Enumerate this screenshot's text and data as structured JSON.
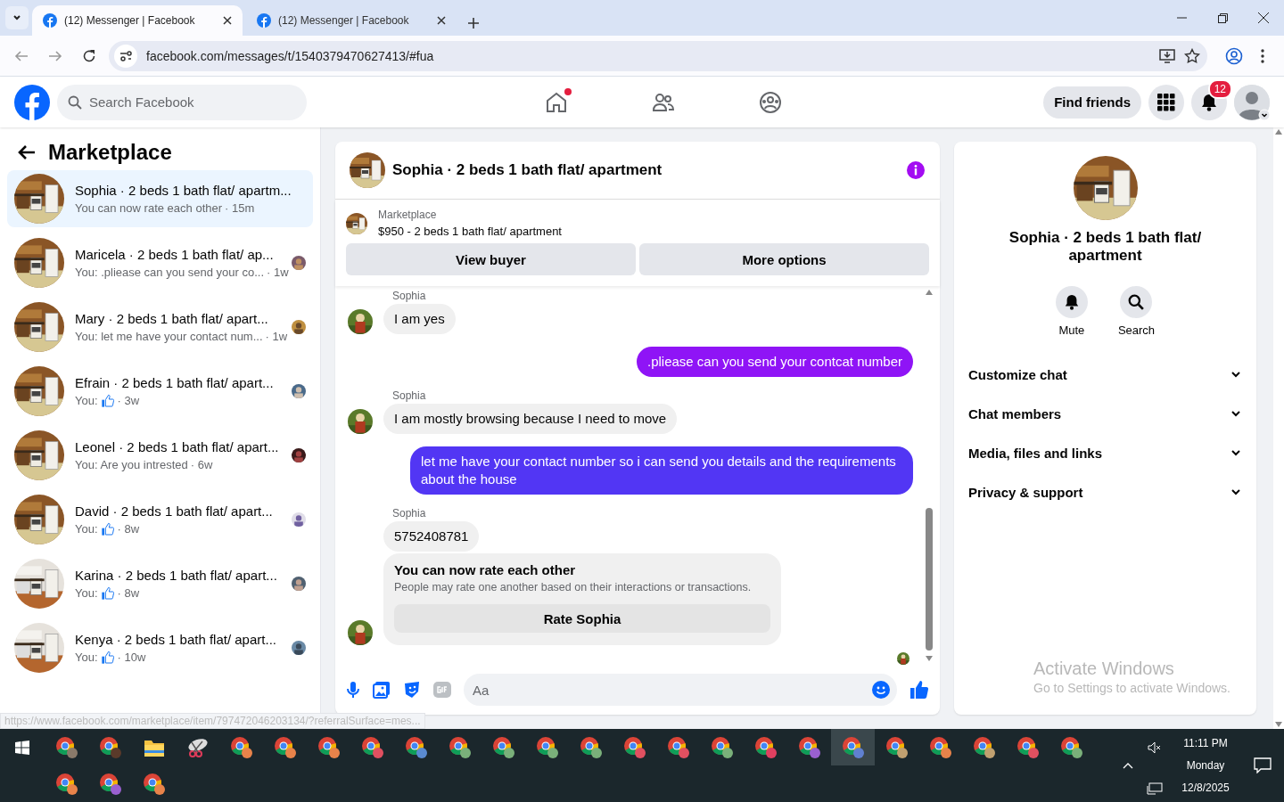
{
  "browser": {
    "tabs": [
      {
        "title": "(12) Messenger | Facebook",
        "selected": true
      },
      {
        "title": "(12) Messenger | Facebook",
        "selected": false
      }
    ],
    "url": "facebook.com/messages/t/1540379470627413/#fua"
  },
  "header": {
    "search_placeholder": "Search Facebook",
    "home_notification": true,
    "find_friends": "Find friends",
    "notification_count": "12"
  },
  "sidebar": {
    "title": "Marketplace",
    "conversations": [
      {
        "title": "Sophia · 2 beds 1 bath flat/ apartm...",
        "kind": "text",
        "preview": "You can now rate each other",
        "time": "· 15m",
        "selected": true,
        "seen": false
      },
      {
        "title": "Maricela · 2 beds 1 bath flat/ ap...",
        "kind": "text",
        "preview": "You: .pliease can you send your co...",
        "time": "· 1w",
        "selected": false,
        "seen": true
      },
      {
        "title": "Mary · 2 beds 1 bath flat/ apart...",
        "kind": "text",
        "preview": "You: let me have your contact num...",
        "time": "· 1w",
        "selected": false,
        "seen": true
      },
      {
        "title": "Efrain · 2 beds 1 bath flat/ apart...",
        "kind": "like",
        "preview": "You:",
        "time": "· 3w",
        "selected": false,
        "seen": true
      },
      {
        "title": "Leonel · 2 beds 1 bath flat/ apart...",
        "kind": "text",
        "preview": "You: Are you intrested",
        "time": "· 6w",
        "selected": false,
        "seen": true
      },
      {
        "title": "David · 2 beds 1 bath flat/ apart...",
        "kind": "like",
        "preview": "You:",
        "time": "· 8w",
        "selected": false,
        "seen": true
      },
      {
        "title": "Karina · 2 beds 1 bath flat/ apart...",
        "kind": "like",
        "preview": "You:",
        "time": "· 8w",
        "selected": false,
        "seen": true
      },
      {
        "title": "Kenya · 2 beds 1 bath flat/ apart...",
        "kind": "like",
        "preview": "You:",
        "time": "· 10w",
        "selected": false,
        "seen": true
      }
    ]
  },
  "chat": {
    "title": "Sophia · 2 beds 1 bath flat/ apartment",
    "listing": {
      "label": "Marketplace",
      "title": "$950 - 2 beds 1 bath flat/ apartment"
    },
    "buttons": [
      "View buyer",
      "More options"
    ],
    "groups": [
      {
        "kind": "incoming",
        "sender": "Sophia",
        "items": [
          {
            "kind": "text",
            "text": "I am yes"
          }
        ]
      },
      {
        "kind": "outgoing",
        "items": [
          {
            "kind": "text",
            "text": ".pliease can you send your contcat number",
            "color": "#8f14f6"
          }
        ]
      },
      {
        "kind": "incoming",
        "sender": "Sophia",
        "items": [
          {
            "kind": "text",
            "text": "I am mostly browsing because I need to move"
          }
        ]
      },
      {
        "kind": "outgoing",
        "items": [
          {
            "kind": "text",
            "text": "let me have your contact number so i can send you details and the requirements about the house",
            "color": "#5236f4"
          }
        ]
      },
      {
        "kind": "incoming",
        "sender": "Sophia",
        "items": [
          {
            "kind": "text",
            "text": "5752408781"
          },
          {
            "kind": "rating",
            "title": "You can now rate each other",
            "text": "People may rate one another based on their interactions or transactions.",
            "button": "Rate Sophia"
          }
        ]
      }
    ],
    "composer_placeholder": "Aa"
  },
  "details": {
    "title": "Sophia · 2 beds 1 bath flat/ apartment",
    "actions": [
      {
        "kind": "bell",
        "label": "Mute"
      },
      {
        "kind": "search",
        "label": "Search"
      }
    ],
    "sections": [
      "Customize chat",
      "Chat members",
      "Media, files and links",
      "Privacy & support"
    ]
  },
  "activation_notice": {
    "title": "Activate Windows",
    "text": "Go to Settings to activate Windows."
  },
  "status_link": "https://www.facebook.com/marketplace/item/797472046203134/?referralSurface=mes...",
  "taskbar": {
    "apps": [
      {
        "kind": "chrome",
        "color": "#8a7a6a",
        "selected": false
      },
      {
        "kind": "chrome",
        "color": "#5a3a2a",
        "selected": false
      },
      {
        "kind": "folder",
        "selected": false
      },
      {
        "kind": "snip",
        "selected": false
      },
      {
        "kind": "chrome",
        "color": "#e8834a",
        "selected": false
      },
      {
        "kind": "chrome",
        "color": "#e8834a",
        "selected": false
      },
      {
        "kind": "chrome",
        "color": "#e8834a",
        "selected": false
      },
      {
        "kind": "chrome",
        "color": "#e05060",
        "selected": false
      },
      {
        "kind": "chrome",
        "color": "#5a8ad0",
        "selected": false
      },
      {
        "kind": "chrome",
        "color": "#7ab07a",
        "selected": false
      },
      {
        "kind": "chrome",
        "color": "#7ab07a",
        "selected": false
      },
      {
        "kind": "chrome",
        "color": "#7ab07a",
        "selected": false
      },
      {
        "kind": "chrome",
        "color": "#7ab07a",
        "selected": false
      },
      {
        "kind": "chrome",
        "color": "#e05060",
        "selected": false
      },
      {
        "kind": "chrome",
        "color": "#e05060",
        "selected": false
      },
      {
        "kind": "chrome",
        "color": "#7ab07a",
        "selected": false
      },
      {
        "kind": "chrome",
        "color": "#e04060",
        "selected": false
      },
      {
        "kind": "chrome",
        "color": "#9a60d0",
        "selected": false
      },
      {
        "kind": "chrome",
        "color": "#6080d0",
        "selected": true
      },
      {
        "kind": "chrome",
        "color": "#c0a070",
        "selected": false
      },
      {
        "kind": "chrome",
        "color": "#e8834a",
        "selected": false
      },
      {
        "kind": "chrome",
        "color": "#c0a070",
        "selected": false
      },
      {
        "kind": "chrome",
        "color": "#e05060",
        "selected": false
      },
      {
        "kind": "chrome",
        "color": "#7ab07a",
        "selected": false
      },
      {
        "kind": "chrome",
        "color": "#e8834a",
        "selected": false
      },
      {
        "kind": "chrome",
        "color": "#9a60d0",
        "selected": false
      },
      {
        "kind": "chrome",
        "color": "#e8834a",
        "selected": false
      }
    ],
    "clock": {
      "time": "11:11 PM",
      "day": "Monday",
      "date": "12/8/2025"
    }
  }
}
